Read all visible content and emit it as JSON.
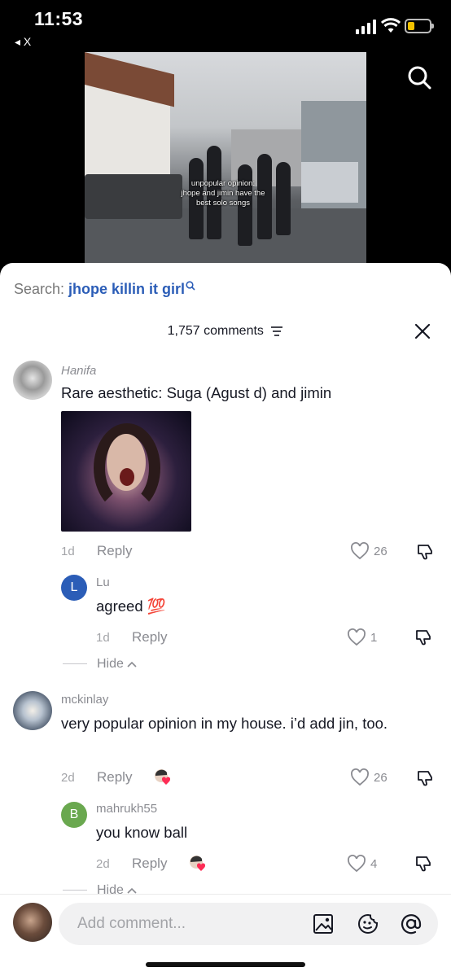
{
  "status": {
    "time": "11:53",
    "back_label": "◂ X"
  },
  "video": {
    "overlay_text": [
      "unpopular opinion:",
      "jhope and jimin have the",
      "best solo songs"
    ]
  },
  "search": {
    "prefix": "Search: ",
    "query": "jhope killin it girl"
  },
  "comments_header": {
    "count_label": "1,757 comments"
  },
  "comments": [
    {
      "user": "Hanifa",
      "text": "Rare aesthetic: Suga (Agust d) and jimin",
      "age": "1d",
      "reply_label": "Reply",
      "likes": "26",
      "replies": [
        {
          "avatar_letter": "L",
          "avatar_color": "#2b5db7",
          "user": "Lu",
          "text": "agreed 💯",
          "age": "1d",
          "reply_label": "Reply",
          "likes": "1"
        }
      ],
      "hide_label": "Hide"
    },
    {
      "user": "mckinlay",
      "text": "very popular opinion in my house. i’d add jin, too.",
      "age": "2d",
      "reply_label": "Reply",
      "likes": "26",
      "replies": [
        {
          "avatar_letter": "B",
          "avatar_color": "#6aa84f",
          "user": "mahrukh55",
          "text": "you know ball",
          "age": "2d",
          "reply_label": "Reply",
          "likes": "4"
        }
      ],
      "hide_label": "Hide"
    }
  ],
  "composer": {
    "placeholder": "Add comment..."
  }
}
